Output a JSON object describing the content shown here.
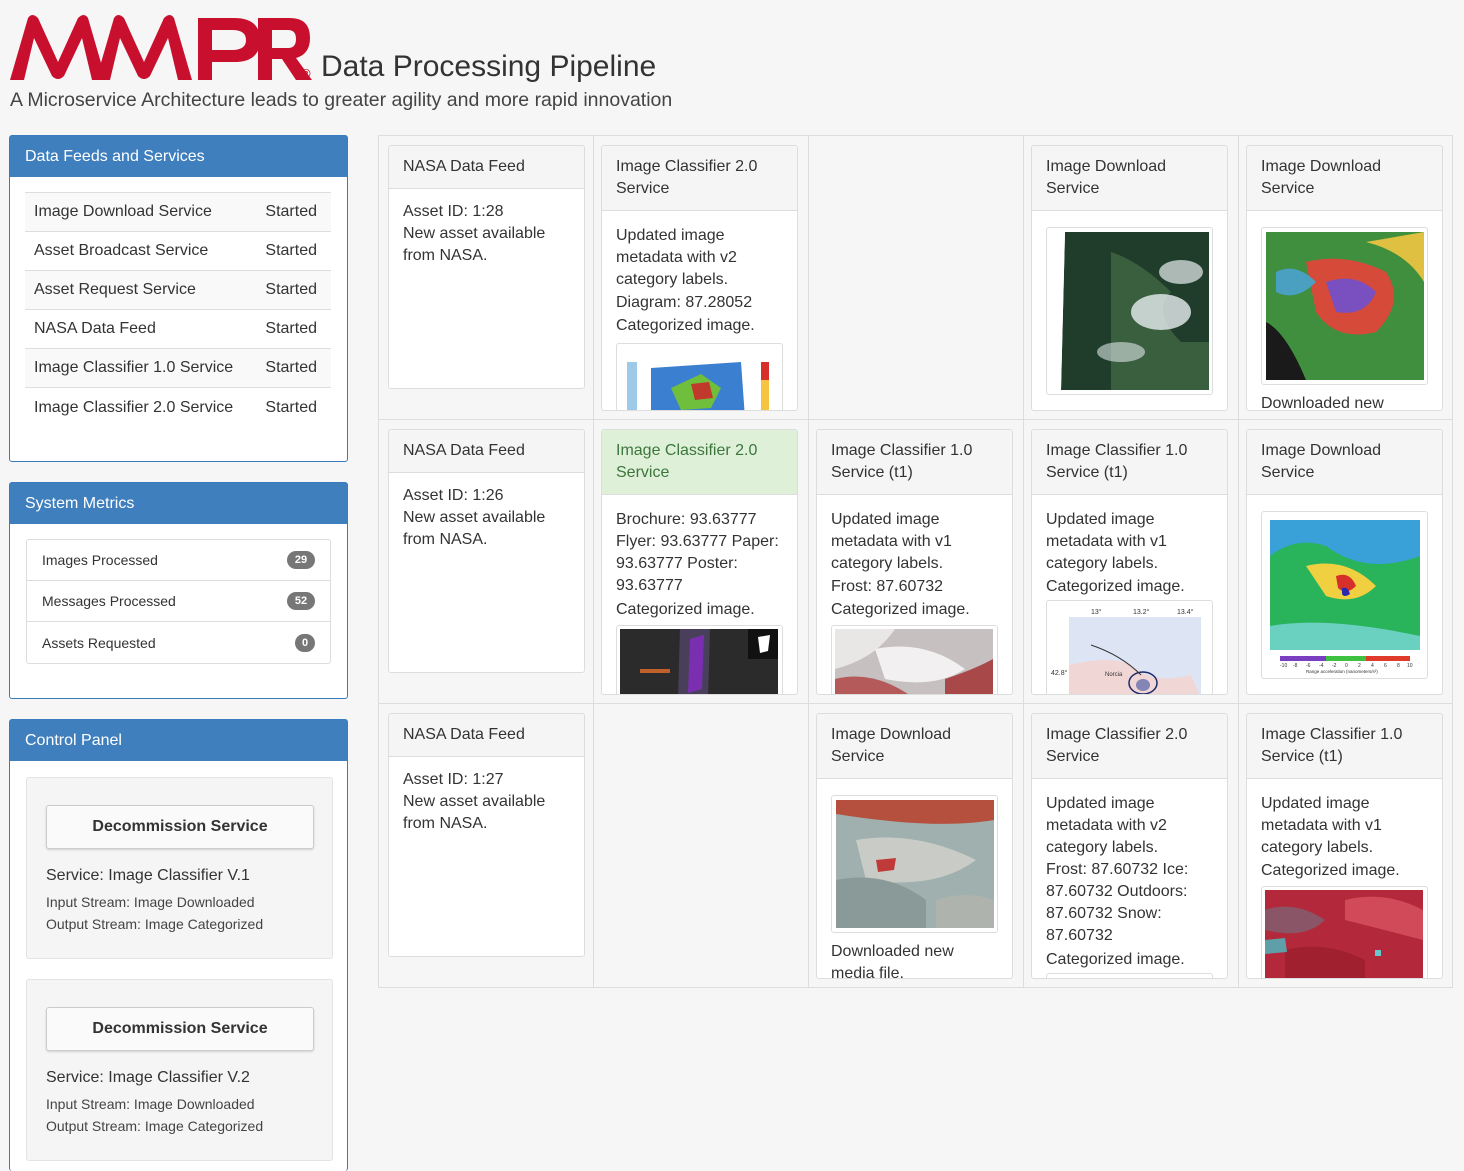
{
  "header": {
    "logo_text": "MAPR",
    "logo_mark": "®",
    "title": "Data Processing Pipeline",
    "subtitle": "A Microservice Architecture leads to greater agility and more rapid innovation"
  },
  "services_panel": {
    "title": "Data Feeds and Services",
    "rows": [
      {
        "name": "Image Download Service",
        "status": "Started"
      },
      {
        "name": "Asset Broadcast Service",
        "status": "Started"
      },
      {
        "name": "Asset Request Service",
        "status": "Started"
      },
      {
        "name": "NASA Data Feed",
        "status": "Started"
      },
      {
        "name": "Image Classifier 1.0 Service",
        "status": "Started"
      },
      {
        "name": "Image Classifier 2.0 Service",
        "status": "Started"
      }
    ]
  },
  "metrics_panel": {
    "title": "System Metrics",
    "rows": [
      {
        "label": "Images Processed",
        "count": "29"
      },
      {
        "label": "Messages Processed",
        "count": "52"
      },
      {
        "label": "Assets Requested",
        "count": "0"
      }
    ]
  },
  "control_panel": {
    "title": "Control Panel",
    "items": [
      {
        "button": "Decommission Service",
        "service": "Service: Image Classifier V.1",
        "input": "Input Stream: Image Downloaded",
        "output": "Output Stream: Image Categorized"
      },
      {
        "button": "Decommission Service",
        "service": "Service: Image Classifier V.2",
        "input": "Input Stream: Image Downloaded",
        "output": "Output Stream: Image Categorized"
      }
    ]
  },
  "cards": {
    "r1c1": {
      "title": "NASA Data Feed",
      "lines": [
        "Asset ID: 1:28",
        "New asset available from NASA."
      ]
    },
    "r1c2": {
      "title": "Image Classifier 2.0 Service",
      "lines": [
        "Updated image metadata with v2 category labels.",
        "Diagram: 87.28052",
        "Categorized image."
      ]
    },
    "r1c4": {
      "title": "Image Download Service"
    },
    "r1c5": {
      "title": "Image Download Service",
      "lines": [
        "Downloaded new"
      ]
    },
    "r2c1": {
      "title": "NASA Data Feed",
      "lines": [
        "Asset ID: 1:26",
        "New asset available from NASA."
      ]
    },
    "r2c2": {
      "title": "Image Classifier 2.0 Service",
      "lines": [
        "Brochure: 93.63777 Flyer: 93.63777 Paper: 93.63777 Poster: 93.63777",
        "Categorized image."
      ]
    },
    "r2c3": {
      "title": "Image Classifier 1.0 Service (t1)",
      "lines": [
        "Updated image metadata with v1 category labels.",
        "Frost: 87.60732",
        "Categorized image."
      ]
    },
    "r2c4": {
      "title": "Image Classifier 1.0 Service (t1)",
      "lines": [
        "Updated image metadata with v1 category labels.",
        "Categorized image."
      ],
      "chart_labels": [
        "13°",
        "13.2°",
        "13.4°",
        "42.8°",
        "Norcia"
      ]
    },
    "r2c5": {
      "title": "Image Download Service",
      "scale_ticks": [
        "-10",
        "-8",
        "-6",
        "-4",
        "-2",
        "0",
        "2",
        "4",
        "6",
        "8",
        "10"
      ],
      "scale_label": "Range acceleration (nanometers/s²)"
    },
    "r3c1": {
      "title": "NASA Data Feed",
      "lines": [
        "Asset ID: 1:27",
        "New asset available from NASA."
      ]
    },
    "r3c3": {
      "title": "Image Download Service",
      "lines": [
        "Downloaded new media file."
      ]
    },
    "r3c4": {
      "title": "Image Classifier 2.0 Service",
      "lines": [
        "Updated image metadata with v2 category labels.",
        "Frost: 87.60732 Ice: 87.60732 Outdoors: 87.60732 Snow: 87.60732",
        "Categorized image."
      ]
    },
    "r3c5": {
      "title": "Image Classifier 1.0 Service (t1)",
      "lines": [
        "Updated image metadata with v1 category labels.",
        "Categorized image."
      ]
    }
  },
  "colors": {
    "brand_red": "#c8102e",
    "panel_blue": "#3f7fbd",
    "success_bg": "#dff0d8",
    "success_text": "#3c763d"
  }
}
